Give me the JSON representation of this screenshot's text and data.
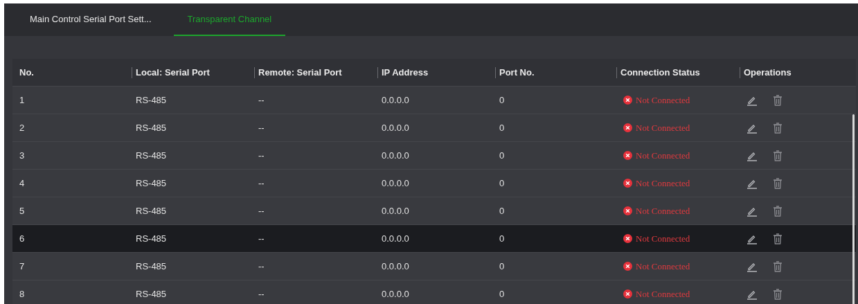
{
  "tabs": [
    {
      "label": "Main Control Serial Port Sett...",
      "selected": false
    },
    {
      "label": "Transparent Channel",
      "selected": true
    }
  ],
  "table": {
    "columns": [
      "No.",
      "Local: Serial Port",
      "Remote: Serial Port",
      "IP Address",
      "Port No.",
      "Connection Status",
      "Operations"
    ],
    "rows": [
      {
        "no": "1",
        "local": "RS-485",
        "remote": "--",
        "ip": "0.0.0.0",
        "port": "0",
        "status": "Not Connected",
        "selected": false
      },
      {
        "no": "2",
        "local": "RS-485",
        "remote": "--",
        "ip": "0.0.0.0",
        "port": "0",
        "status": "Not Connected",
        "selected": false
      },
      {
        "no": "3",
        "local": "RS-485",
        "remote": "--",
        "ip": "0.0.0.0",
        "port": "0",
        "status": "Not Connected",
        "selected": false
      },
      {
        "no": "4",
        "local": "RS-485",
        "remote": "--",
        "ip": "0.0.0.0",
        "port": "0",
        "status": "Not Connected",
        "selected": false
      },
      {
        "no": "5",
        "local": "RS-485",
        "remote": "--",
        "ip": "0.0.0.0",
        "port": "0",
        "status": "Not Connected",
        "selected": false
      },
      {
        "no": "6",
        "local": "RS-485",
        "remote": "--",
        "ip": "0.0.0.0",
        "port": "0",
        "status": "Not Connected",
        "selected": true
      },
      {
        "no": "7",
        "local": "RS-485",
        "remote": "--",
        "ip": "0.0.0.0",
        "port": "0",
        "status": "Not Connected",
        "selected": false
      },
      {
        "no": "8",
        "local": "RS-485",
        "remote": "--",
        "ip": "0.0.0.0",
        "port": "0",
        "status": "Not Connected",
        "selected": false
      }
    ]
  }
}
